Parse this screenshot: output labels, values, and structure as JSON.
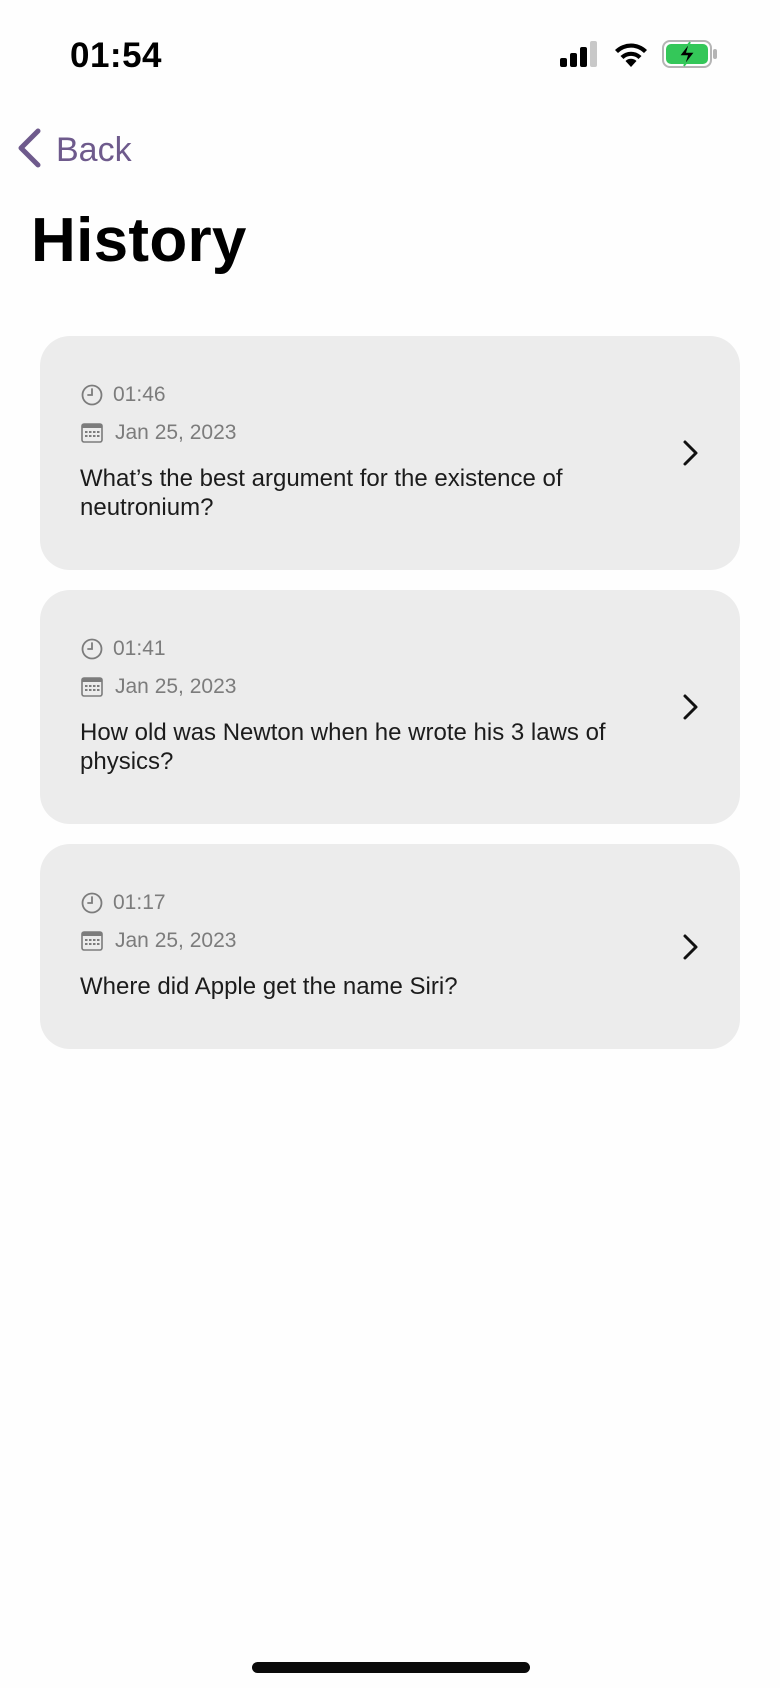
{
  "status_bar": {
    "time": "01:54",
    "icons": [
      "cellular-signal-icon",
      "wifi-icon",
      "battery-charging-icon"
    ],
    "battery_color": "#34c759"
  },
  "nav": {
    "back_label": "Back",
    "accent_color": "#6e5a8c"
  },
  "page": {
    "title": "History"
  },
  "history": [
    {
      "time": "01:46",
      "date": "Jan 25, 2023",
      "question": "What’s the best argument for the existence of neutronium?"
    },
    {
      "time": "01:41",
      "date": "Jan 25, 2023",
      "question": "How old was Newton when he wrote his 3 laws of physics?"
    },
    {
      "time": "01:17",
      "date": "Jan 25, 2023",
      "question": "Where did Apple get the name Siri?"
    }
  ]
}
